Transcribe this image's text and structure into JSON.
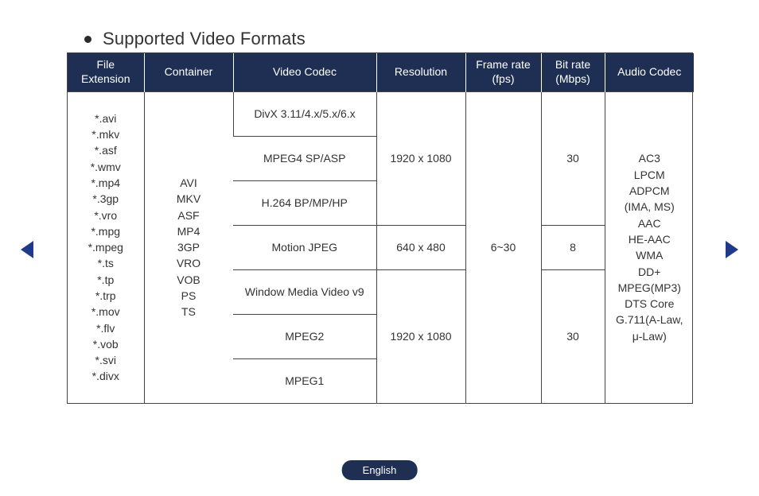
{
  "heading": "Supported Video Formats",
  "headers": {
    "ext": "File\nExtension",
    "container": "Container",
    "vcodec": "Video Codec",
    "res": "Resolution",
    "fps": "Frame rate\n(fps)",
    "bitrate": "Bit rate\n(Mbps)",
    "acodec": "Audio Codec"
  },
  "file_extensions": "*.avi\n*.mkv\n*.asf\n*.wmv\n*.mp4\n*.3gp\n*.vro\n*.mpg\n*.mpeg\n*.ts\n*.tp\n*.trp\n*.mov\n*.flv\n*.vob\n*.svi\n*.divx",
  "containers": "AVI\nMKV\nASF\nMP4\n3GP\nVRO\nVOB\nPS\nTS",
  "video_codecs": {
    "c1": "DivX 3.11/4.x/5.x/6.x",
    "c2": "MPEG4 SP/ASP",
    "c3": "H.264 BP/MP/HP",
    "c4": "Motion JPEG",
    "c5": "Window Media Video v9",
    "c6": "MPEG2",
    "c7": "MPEG1"
  },
  "resolutions": {
    "r1": "1920 x 1080",
    "r2": "640 x 480",
    "r3": "1920 x 1080"
  },
  "frame_rate": "6~30",
  "bitrates": {
    "b1": "30",
    "b2": "8",
    "b3": "30"
  },
  "audio_codecs": "AC3\nLPCM\nADPCM\n(IMA, MS)\nAAC\nHE-AAC\nWMA\nDD+\nMPEG(MP3)\nDTS Core\nG.711(A-Law,\nμ-Law)",
  "language": "English"
}
